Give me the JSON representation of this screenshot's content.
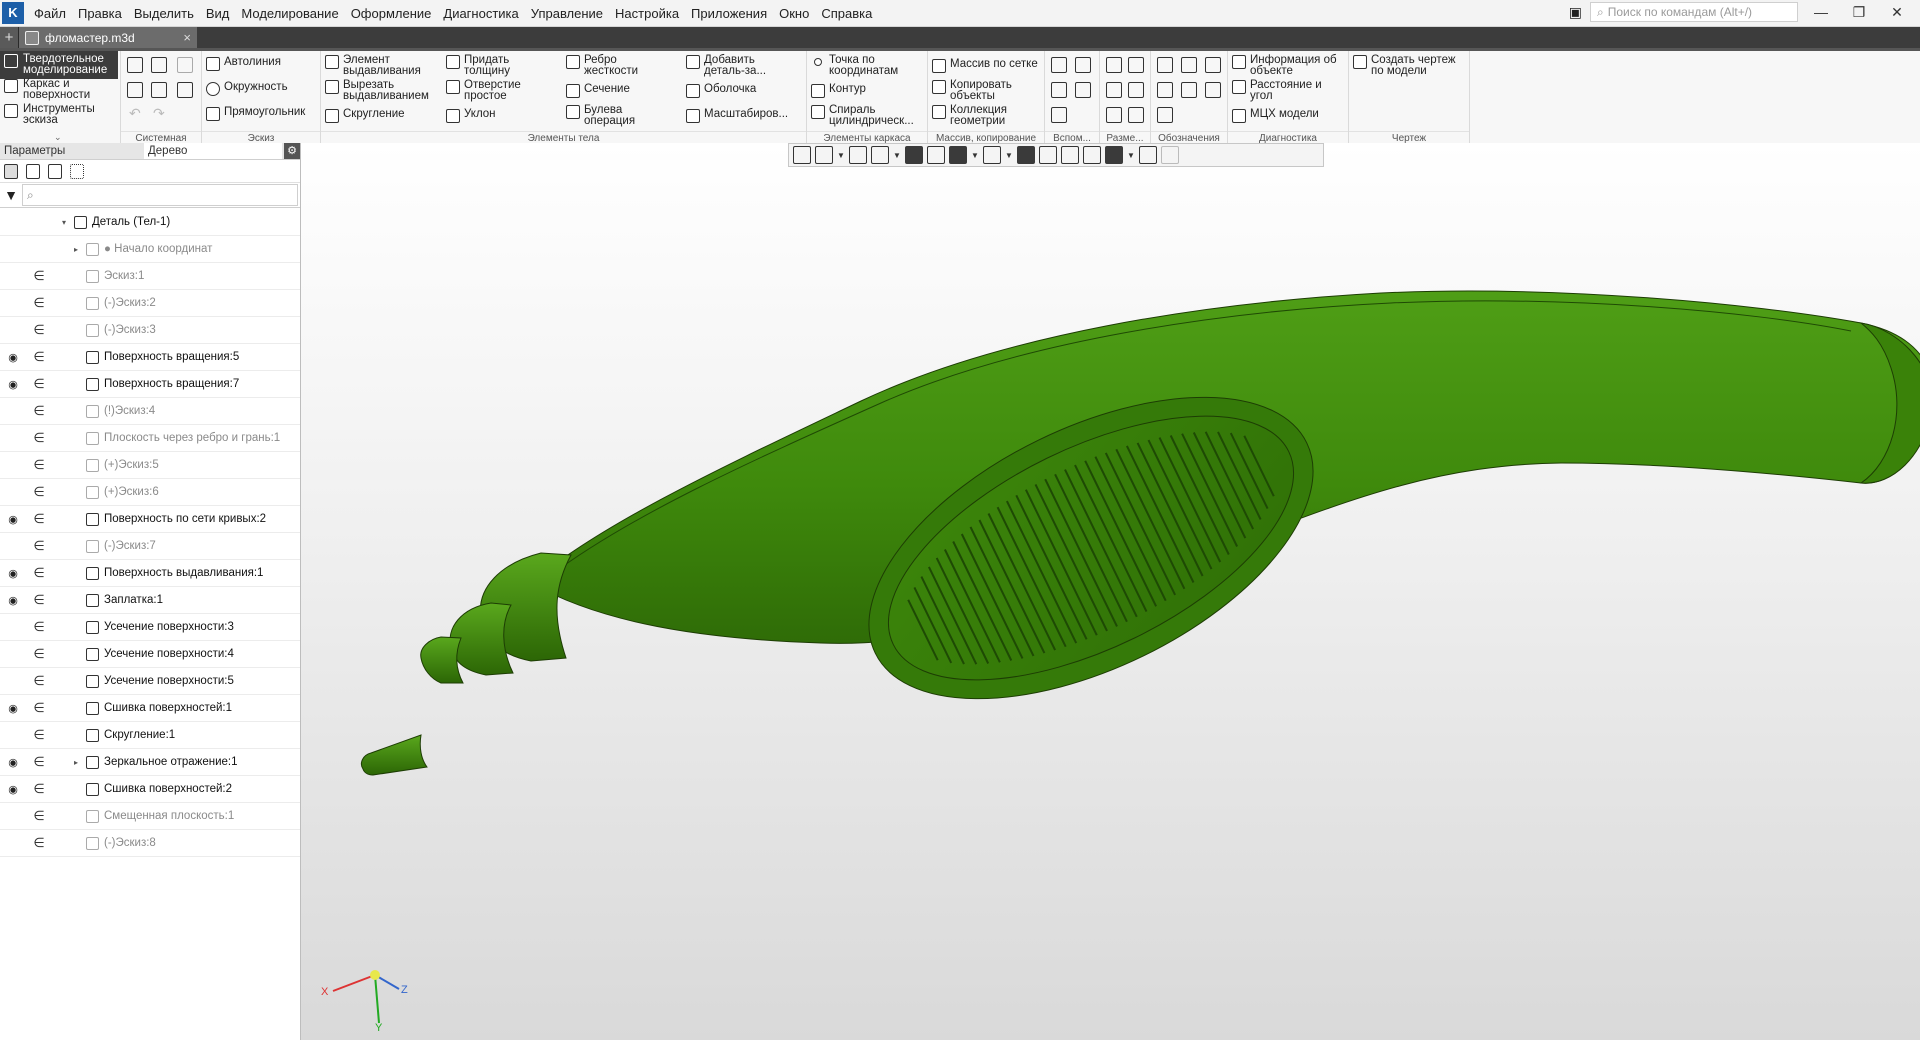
{
  "menubar": {
    "logo": "K",
    "items": [
      "Файл",
      "Правка",
      "Выделить",
      "Вид",
      "Моделирование",
      "Оформление",
      "Диагностика",
      "Управление",
      "Настройка",
      "Приложения",
      "Окно",
      "Справка"
    ],
    "search_placeholder": "Поиск по командам (Alt+/)",
    "window_buttons": [
      "—",
      "❐",
      "✕"
    ]
  },
  "tabs": {
    "add": "+",
    "doc_name": "фломастер.m3d",
    "close": "×"
  },
  "ribbon": {
    "modes": [
      "Твердотельное моделирование",
      "Каркас и поверхности",
      "Инструменты эскиза"
    ],
    "groups": [
      {
        "label": "Системная"
      },
      {
        "label": "Эскиз",
        "buttons": [
          "Автолиния",
          "Окружность",
          "Прямоугольник"
        ]
      },
      {
        "label": "Элементы тела",
        "buttons": [
          "Элемент выдавливания",
          "Вырезать выдавливанием",
          "Скругление",
          "Придать толщину",
          "Отверстие простое",
          "Уклон",
          "Ребро жесткости",
          "Сечение",
          "Булева операция",
          "Добавить деталь-за...",
          "Оболочка",
          "Масштабиров..."
        ]
      },
      {
        "label": "Элементы каркаса",
        "buttons": [
          "Точка по координатам",
          "Контур",
          "Спираль цилиндрическ..."
        ]
      },
      {
        "label": "Массив, копирование",
        "buttons": [
          "Массив по сетке",
          "Копировать объекты",
          "Коллекция геометрии"
        ]
      },
      {
        "label": "Вспом..."
      },
      {
        "label": "Разме..."
      },
      {
        "label": "Обозначения"
      },
      {
        "label": "Диагностика",
        "buttons": [
          "Информация об объекте",
          "Расстояние и угол",
          "МЦХ модели"
        ]
      },
      {
        "label": "Чертеж",
        "buttons": [
          "Создать чертеж по модели"
        ]
      }
    ]
  },
  "panel": {
    "tab_params": "Параметры",
    "tab_tree": "Дерево",
    "gear": "⚙",
    "search_icon": "⌕"
  },
  "tree": [
    {
      "label": "Деталь (Тел-1)",
      "eye": "",
      "rel": "",
      "level": 0,
      "expand": "▾",
      "dim": false
    },
    {
      "label": "● Начало координат",
      "eye": "",
      "rel": "",
      "level": 1,
      "expand": "▸",
      "dim": true
    },
    {
      "label": "Эскиз:1",
      "eye": "",
      "rel": "∈",
      "level": 1,
      "expand": "",
      "dim": true
    },
    {
      "label": "(-)Эскиз:2",
      "eye": "",
      "rel": "∈",
      "level": 1,
      "expand": "",
      "dim": true
    },
    {
      "label": "(-)Эскиз:3",
      "eye": "",
      "rel": "∈",
      "level": 1,
      "expand": "",
      "dim": true
    },
    {
      "label": "Поверхность вращения:5",
      "eye": "◉",
      "rel": "∈",
      "level": 1,
      "expand": "",
      "dim": false
    },
    {
      "label": "Поверхность вращения:7",
      "eye": "◉",
      "rel": "∈",
      "level": 1,
      "expand": "",
      "dim": false
    },
    {
      "label": "(!)Эскиз:4",
      "eye": "",
      "rel": "∈",
      "level": 1,
      "expand": "",
      "dim": true
    },
    {
      "label": "Плоскость через ребро и грань:1",
      "eye": "",
      "rel": "∈",
      "level": 1,
      "expand": "",
      "dim": true
    },
    {
      "label": "(+)Эскиз:5",
      "eye": "",
      "rel": "∈",
      "level": 1,
      "expand": "",
      "dim": true
    },
    {
      "label": "(+)Эскиз:6",
      "eye": "",
      "rel": "∈",
      "level": 1,
      "expand": "",
      "dim": true
    },
    {
      "label": "Поверхность по сети кривых:2",
      "eye": "◉",
      "rel": "∈",
      "level": 1,
      "expand": "",
      "dim": false
    },
    {
      "label": "(-)Эскиз:7",
      "eye": "",
      "rel": "∈",
      "level": 1,
      "expand": "",
      "dim": true
    },
    {
      "label": "Поверхность выдавливания:1",
      "eye": "◉",
      "rel": "∈",
      "level": 1,
      "expand": "",
      "dim": false
    },
    {
      "label": "Заплатка:1",
      "eye": "◉",
      "rel": "∈",
      "level": 1,
      "expand": "",
      "dim": false
    },
    {
      "label": "Усечение поверхности:3",
      "eye": "",
      "rel": "∈",
      "level": 1,
      "expand": "",
      "dim": false
    },
    {
      "label": "Усечение поверхности:4",
      "eye": "",
      "rel": "∈",
      "level": 1,
      "expand": "",
      "dim": false
    },
    {
      "label": "Усечение поверхности:5",
      "eye": "",
      "rel": "∈",
      "level": 1,
      "expand": "",
      "dim": false
    },
    {
      "label": "Сшивка поверхностей:1",
      "eye": "◉",
      "rel": "∈",
      "level": 1,
      "expand": "",
      "dim": false
    },
    {
      "label": "Скругление:1",
      "eye": "",
      "rel": "∈",
      "level": 1,
      "expand": "",
      "dim": false
    },
    {
      "label": "Зеркальное отражение:1",
      "eye": "◉",
      "rel": "∈",
      "level": 1,
      "expand": "▸",
      "dim": false
    },
    {
      "label": "Сшивка поверхностей:2",
      "eye": "◉",
      "rel": "∈",
      "level": 1,
      "expand": "",
      "dim": false
    },
    {
      "label": "Смещенная плоскость:1",
      "eye": "",
      "rel": "∈",
      "level": 1,
      "expand": "",
      "dim": true
    },
    {
      "label": "(-)Эскиз:8",
      "eye": "",
      "rel": "∈",
      "level": 1,
      "expand": "",
      "dim": true
    }
  ],
  "axes": {
    "x": "X",
    "y": "Y",
    "z": "Z"
  },
  "colors": {
    "model": "#3f8a0c",
    "model_dark": "#2c6706",
    "model_light": "#58a91b",
    "accent": "#3c3c3c"
  }
}
